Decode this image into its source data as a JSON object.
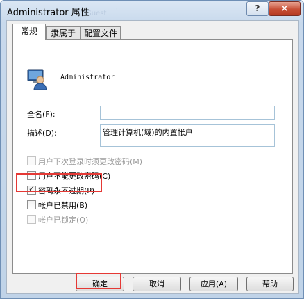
{
  "window": {
    "title": "Administrator 属性",
    "ghost_tab_label": "Guest",
    "help_label": "?",
    "close_label": "×"
  },
  "tabs": [
    {
      "label": "常规"
    },
    {
      "label": "隶属于"
    },
    {
      "label": "配置文件"
    }
  ],
  "user": {
    "name": "Administrator"
  },
  "fields": {
    "fullname_label": "全名(F):",
    "fullname_value": "",
    "description_label": "描述(D):",
    "description_value": "管理计算机(域)的内置帐户"
  },
  "checkboxes": [
    {
      "label": "用户下次登录时须更改密码(M)",
      "checked": false,
      "disabled": true
    },
    {
      "label": "用户不能更改密码(C)",
      "checked": false,
      "disabled": false
    },
    {
      "label": "密码永不过期(P)",
      "checked": true,
      "disabled": false
    },
    {
      "label": "帐户已禁用(B)",
      "checked": false,
      "disabled": false
    },
    {
      "label": "帐户已锁定(O)",
      "checked": false,
      "disabled": true
    }
  ],
  "buttons": {
    "ok": "确定",
    "cancel": "取消",
    "apply": "应用(A)",
    "help": "帮助"
  },
  "colors": {
    "highlight_box": "#e53935",
    "input_border": "#a6c3d8",
    "titlebar": "#c8d9ec"
  }
}
